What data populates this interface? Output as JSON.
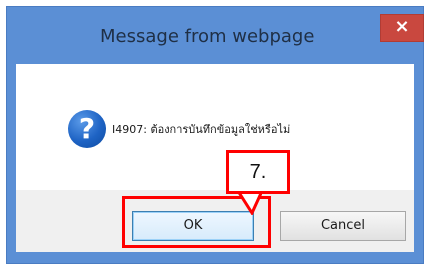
{
  "window": {
    "title": "Message from webpage",
    "close_symbol": "×"
  },
  "message": {
    "icon": "question-icon",
    "text": "I4907: ต้องการบันทึกข้อมูลใช่หรือไม่"
  },
  "buttons": {
    "ok_label": "OK",
    "cancel_label": "Cancel"
  },
  "annotation": {
    "callout_label": "7.",
    "color": "#ff0000"
  },
  "colors": {
    "title_bar": "#5b8fd5",
    "close_button": "#c9483f"
  }
}
